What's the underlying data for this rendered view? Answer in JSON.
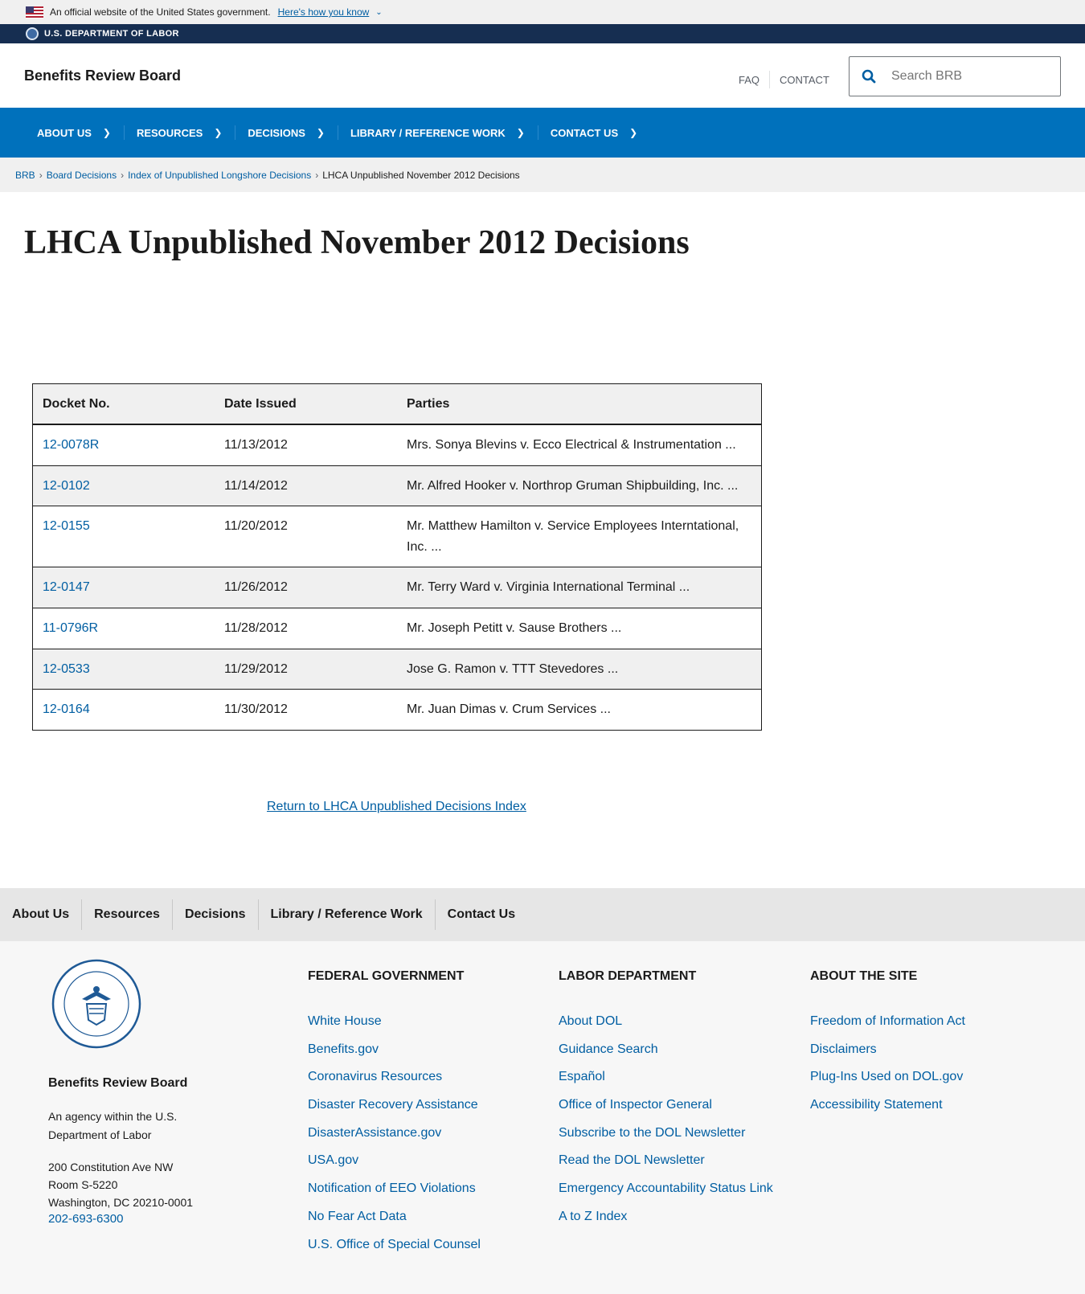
{
  "gov_banner": {
    "text": "An official website of the United States government.",
    "how_link": "Here's how you know"
  },
  "dol_strip": {
    "text": "U.S. DEPARTMENT OF LABOR"
  },
  "header": {
    "site_title": "Benefits Review Board",
    "links": [
      "FAQ",
      "CONTACT"
    ],
    "search_placeholder": "Search BRB"
  },
  "nav": {
    "items": [
      "ABOUT US",
      "RESOURCES",
      "DECISIONS",
      "LIBRARY / REFERENCE WORK",
      "CONTACT US"
    ]
  },
  "breadcrumb": {
    "items": [
      "BRB",
      "Board Decisions",
      "Index of Unpublished Longshore Decisions"
    ],
    "current": "LHCA Unpublished November 2012 Decisions"
  },
  "main": {
    "title": "LHCA Unpublished November 2012 Decisions",
    "table": {
      "headers": [
        "Docket No.",
        "Date Issued",
        "Parties"
      ],
      "rows": [
        {
          "docket": "12-0078R",
          "date": "11/13/2012",
          "parties": "Mrs. Sonya Blevins v. Ecco Electrical & Instrumentation ..."
        },
        {
          "docket": "12-0102",
          "date": "11/14/2012",
          "parties": "Mr. Alfred Hooker v. Northrop Gruman Shipbuilding, Inc. ..."
        },
        {
          "docket": "12-0155",
          "date": "11/20/2012",
          "parties": "Mr. Matthew Hamilton v. Service Employees Interntational, Inc. ..."
        },
        {
          "docket": "12-0147",
          "date": "11/26/2012",
          "parties": "Mr. Terry Ward v. Virginia International Terminal ..."
        },
        {
          "docket": "11-0796R",
          "date": "11/28/2012",
          "parties": "Mr. Joseph Petitt v. Sause Brothers ..."
        },
        {
          "docket": "12-0533",
          "date": "11/29/2012",
          "parties": "Jose G. Ramon v. TTT Stevedores ..."
        },
        {
          "docket": "12-0164",
          "date": "11/30/2012",
          "parties": "Mr. Juan Dimas v. Crum Services ..."
        }
      ]
    },
    "return_link": "Return to LHCA Unpublished Decisions Index"
  },
  "footer_nav": {
    "items": [
      "About Us",
      "Resources",
      "Decisions",
      "Library / Reference Work",
      "Contact Us"
    ]
  },
  "footer": {
    "agency_name": "Benefits Review Board",
    "agency_desc": "An agency within the U.S. Department of Labor",
    "address": [
      "200 Constitution Ave NW",
      "Room S-5220",
      "Washington, DC 20210-0001"
    ],
    "phone": "202-693-6300",
    "columns": [
      {
        "heading": "FEDERAL GOVERNMENT",
        "links": [
          "White House",
          "Benefits.gov",
          "Coronavirus Resources",
          "Disaster Recovery Assistance",
          "DisasterAssistance.gov",
          "USA.gov",
          "Notification of EEO Violations",
          "No Fear Act Data",
          "U.S. Office of Special Counsel"
        ]
      },
      {
        "heading": "LABOR DEPARTMENT",
        "links": [
          "About DOL",
          "Guidance Search",
          "Español",
          "Office of Inspector General",
          "Subscribe to the DOL Newsletter",
          "Read the DOL Newsletter",
          "Emergency Accountability Status Link",
          "A to Z Index"
        ]
      },
      {
        "heading": "ABOUT THE SITE",
        "links": [
          "Freedom of Information Act",
          "Disclaimers",
          "Plug-Ins Used on DOL.gov",
          "Accessibility Statement"
        ]
      }
    ]
  }
}
